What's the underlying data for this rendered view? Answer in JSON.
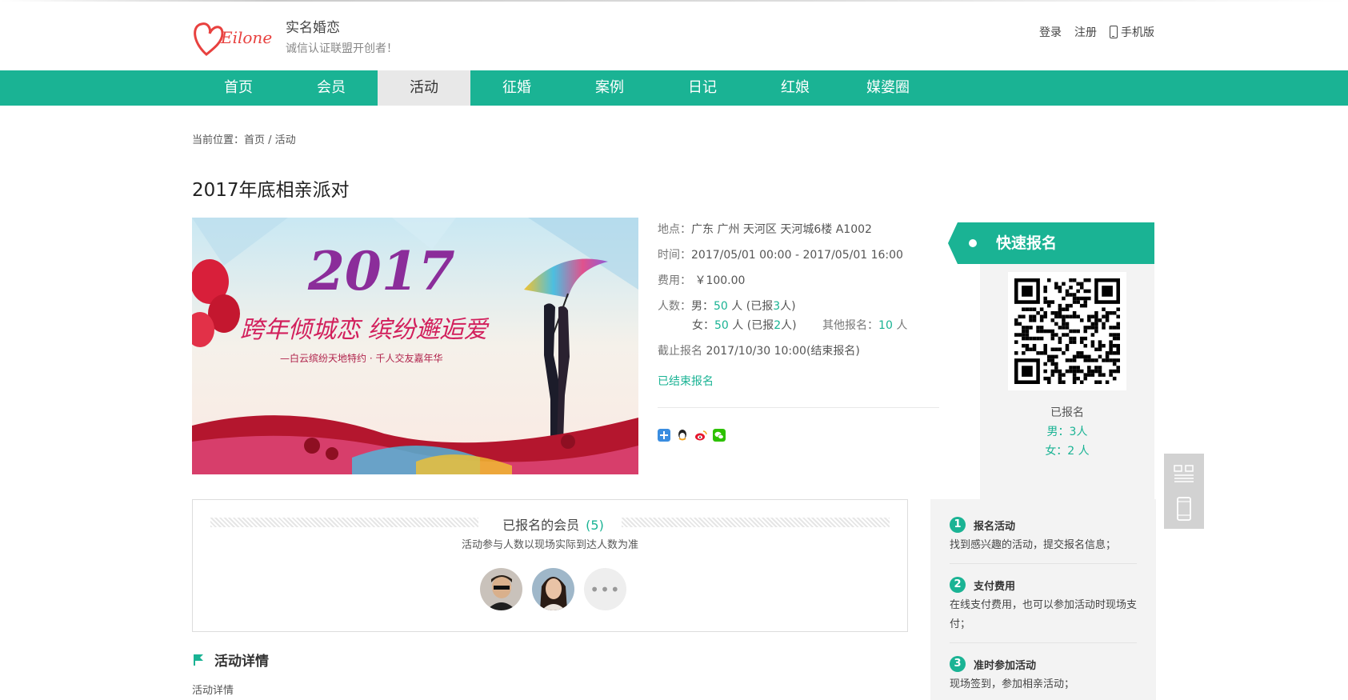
{
  "header": {
    "site_name": "实名婚恋",
    "slogan": "诚信认证联盟开创者！",
    "login": "登录",
    "register": "注册",
    "mobile": "手机版",
    "logo_text": "Eilone"
  },
  "nav": {
    "items": [
      "首页",
      "会员",
      "活动",
      "征婚",
      "案例",
      "日记",
      "红娘",
      "媒婆圈"
    ],
    "active": "活动"
  },
  "breadcrumb": "当前位置：首页 / 活动",
  "event": {
    "title": "2017年底相亲派对",
    "banner_year": "2017",
    "banner_text": "跨年倾城恋  缤纷邂逅爱",
    "banner_subtext": "—白云缤纷天地特约 · 千人交友嘉年华",
    "location_label": "地点：",
    "location": "广东 广州 天河区 天河城6楼 A1002",
    "time_label": "时间：",
    "time": "2017/05/01 00:00 - 2017/05/01 16:00",
    "fee_label": "费用：",
    "fee": "￥100.00",
    "people_label": "人数：",
    "male_label": "男：",
    "male_count": "50",
    "male_unit": " 人 (已报",
    "male_reg": "3",
    "male_tail": "人)",
    "female_label": "女：",
    "female_count": "50",
    "female_unit": " 人 (已报",
    "female_reg": "2",
    "female_tail": "人)",
    "other_label": "其他报名：",
    "other_count": "10",
    "other_unit": " 人",
    "deadline_label": "截止报名",
    "deadline": "2017/10/30 10:00(结束报名)",
    "status": "已结束报名"
  },
  "share": {
    "icons": [
      "share-plus-icon",
      "qq-icon",
      "weibo-icon",
      "wechat-icon"
    ]
  },
  "quick": {
    "title": "快速报名",
    "registered_label": "已报名",
    "male": "男：3人",
    "female": "女：2 人"
  },
  "members": {
    "title": "已报名的会员",
    "count": "(5)",
    "subtitle": "活动参与人数以现场实际到达人数为准",
    "more": "•••"
  },
  "details": {
    "title": "活动详情",
    "body": "活动详情"
  },
  "steps": [
    {
      "num": "1",
      "title": "报名活动",
      "text": "找到感兴趣的活动，提交报名信息；"
    },
    {
      "num": "2",
      "title": "支付费用",
      "text": "在线支付费用，也可以参加活动时现场支付；"
    },
    {
      "num": "3",
      "title": "准时参加活动",
      "text": "现场签到，参加相亲活动；"
    }
  ],
  "colors": {
    "accent": "#1ab394",
    "nav_active_bg": "#e8e8e8",
    "panel_bg": "#f3f3f3"
  }
}
